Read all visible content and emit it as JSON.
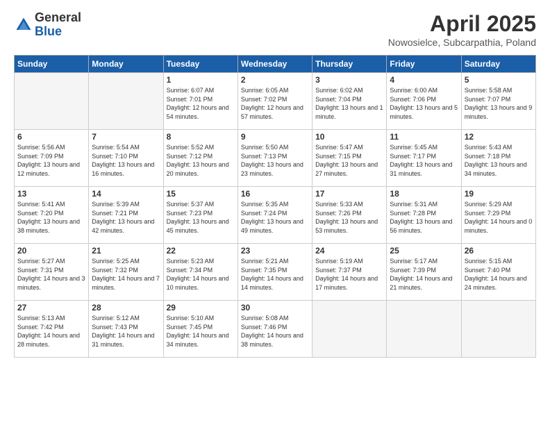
{
  "logo": {
    "general": "General",
    "blue": "Blue"
  },
  "header": {
    "month": "April 2025",
    "location": "Nowosielce, Subcarpathia, Poland"
  },
  "weekdays": [
    "Sunday",
    "Monday",
    "Tuesday",
    "Wednesday",
    "Thursday",
    "Friday",
    "Saturday"
  ],
  "days": [
    {
      "date": "",
      "sunrise": "",
      "sunset": "",
      "daylight": ""
    },
    {
      "date": "",
      "sunrise": "",
      "sunset": "",
      "daylight": ""
    },
    {
      "date": "1",
      "sunrise": "Sunrise: 6:07 AM",
      "sunset": "Sunset: 7:01 PM",
      "daylight": "Daylight: 12 hours and 54 minutes."
    },
    {
      "date": "2",
      "sunrise": "Sunrise: 6:05 AM",
      "sunset": "Sunset: 7:02 PM",
      "daylight": "Daylight: 12 hours and 57 minutes."
    },
    {
      "date": "3",
      "sunrise": "Sunrise: 6:02 AM",
      "sunset": "Sunset: 7:04 PM",
      "daylight": "Daylight: 13 hours and 1 minute."
    },
    {
      "date": "4",
      "sunrise": "Sunrise: 6:00 AM",
      "sunset": "Sunset: 7:06 PM",
      "daylight": "Daylight: 13 hours and 5 minutes."
    },
    {
      "date": "5",
      "sunrise": "Sunrise: 5:58 AM",
      "sunset": "Sunset: 7:07 PM",
      "daylight": "Daylight: 13 hours and 9 minutes."
    },
    {
      "date": "6",
      "sunrise": "Sunrise: 5:56 AM",
      "sunset": "Sunset: 7:09 PM",
      "daylight": "Daylight: 13 hours and 12 minutes."
    },
    {
      "date": "7",
      "sunrise": "Sunrise: 5:54 AM",
      "sunset": "Sunset: 7:10 PM",
      "daylight": "Daylight: 13 hours and 16 minutes."
    },
    {
      "date": "8",
      "sunrise": "Sunrise: 5:52 AM",
      "sunset": "Sunset: 7:12 PM",
      "daylight": "Daylight: 13 hours and 20 minutes."
    },
    {
      "date": "9",
      "sunrise": "Sunrise: 5:50 AM",
      "sunset": "Sunset: 7:13 PM",
      "daylight": "Daylight: 13 hours and 23 minutes."
    },
    {
      "date": "10",
      "sunrise": "Sunrise: 5:47 AM",
      "sunset": "Sunset: 7:15 PM",
      "daylight": "Daylight: 13 hours and 27 minutes."
    },
    {
      "date": "11",
      "sunrise": "Sunrise: 5:45 AM",
      "sunset": "Sunset: 7:17 PM",
      "daylight": "Daylight: 13 hours and 31 minutes."
    },
    {
      "date": "12",
      "sunrise": "Sunrise: 5:43 AM",
      "sunset": "Sunset: 7:18 PM",
      "daylight": "Daylight: 13 hours and 34 minutes."
    },
    {
      "date": "13",
      "sunrise": "Sunrise: 5:41 AM",
      "sunset": "Sunset: 7:20 PM",
      "daylight": "Daylight: 13 hours and 38 minutes."
    },
    {
      "date": "14",
      "sunrise": "Sunrise: 5:39 AM",
      "sunset": "Sunset: 7:21 PM",
      "daylight": "Daylight: 13 hours and 42 minutes."
    },
    {
      "date": "15",
      "sunrise": "Sunrise: 5:37 AM",
      "sunset": "Sunset: 7:23 PM",
      "daylight": "Daylight: 13 hours and 45 minutes."
    },
    {
      "date": "16",
      "sunrise": "Sunrise: 5:35 AM",
      "sunset": "Sunset: 7:24 PM",
      "daylight": "Daylight: 13 hours and 49 minutes."
    },
    {
      "date": "17",
      "sunrise": "Sunrise: 5:33 AM",
      "sunset": "Sunset: 7:26 PM",
      "daylight": "Daylight: 13 hours and 53 minutes."
    },
    {
      "date": "18",
      "sunrise": "Sunrise: 5:31 AM",
      "sunset": "Sunset: 7:28 PM",
      "daylight": "Daylight: 13 hours and 56 minutes."
    },
    {
      "date": "19",
      "sunrise": "Sunrise: 5:29 AM",
      "sunset": "Sunset: 7:29 PM",
      "daylight": "Daylight: 14 hours and 0 minutes."
    },
    {
      "date": "20",
      "sunrise": "Sunrise: 5:27 AM",
      "sunset": "Sunset: 7:31 PM",
      "daylight": "Daylight: 14 hours and 3 minutes."
    },
    {
      "date": "21",
      "sunrise": "Sunrise: 5:25 AM",
      "sunset": "Sunset: 7:32 PM",
      "daylight": "Daylight: 14 hours and 7 minutes."
    },
    {
      "date": "22",
      "sunrise": "Sunrise: 5:23 AM",
      "sunset": "Sunset: 7:34 PM",
      "daylight": "Daylight: 14 hours and 10 minutes."
    },
    {
      "date": "23",
      "sunrise": "Sunrise: 5:21 AM",
      "sunset": "Sunset: 7:35 PM",
      "daylight": "Daylight: 14 hours and 14 minutes."
    },
    {
      "date": "24",
      "sunrise": "Sunrise: 5:19 AM",
      "sunset": "Sunset: 7:37 PM",
      "daylight": "Daylight: 14 hours and 17 minutes."
    },
    {
      "date": "25",
      "sunrise": "Sunrise: 5:17 AM",
      "sunset": "Sunset: 7:39 PM",
      "daylight": "Daylight: 14 hours and 21 minutes."
    },
    {
      "date": "26",
      "sunrise": "Sunrise: 5:15 AM",
      "sunset": "Sunset: 7:40 PM",
      "daylight": "Daylight: 14 hours and 24 minutes."
    },
    {
      "date": "27",
      "sunrise": "Sunrise: 5:13 AM",
      "sunset": "Sunset: 7:42 PM",
      "daylight": "Daylight: 14 hours and 28 minutes."
    },
    {
      "date": "28",
      "sunrise": "Sunrise: 5:12 AM",
      "sunset": "Sunset: 7:43 PM",
      "daylight": "Daylight: 14 hours and 31 minutes."
    },
    {
      "date": "29",
      "sunrise": "Sunrise: 5:10 AM",
      "sunset": "Sunset: 7:45 PM",
      "daylight": "Daylight: 14 hours and 34 minutes."
    },
    {
      "date": "30",
      "sunrise": "Sunrise: 5:08 AM",
      "sunset": "Sunset: 7:46 PM",
      "daylight": "Daylight: 14 hours and 38 minutes."
    },
    {
      "date": "",
      "sunrise": "",
      "sunset": "",
      "daylight": ""
    },
    {
      "date": "",
      "sunrise": "",
      "sunset": "",
      "daylight": ""
    },
    {
      "date": "",
      "sunrise": "",
      "sunset": "",
      "daylight": ""
    }
  ]
}
